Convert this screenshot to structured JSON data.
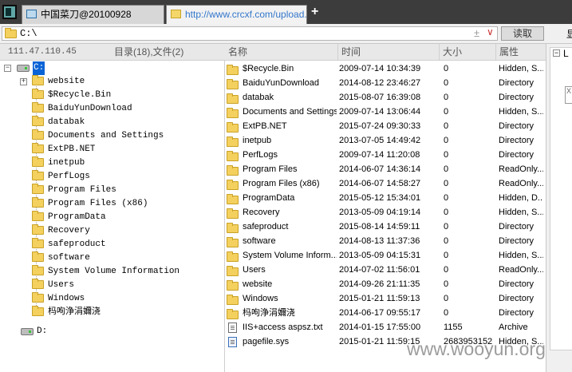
{
  "tabs": [
    {
      "label": "中国菜刀@20100928"
    },
    {
      "label": "http://www.crcxf.com/upload..."
    }
  ],
  "new_tab_label": "+",
  "toolbar": {
    "path": "C:\\",
    "read_label": "读取",
    "extra_label": "显"
  },
  "info": {
    "ip": "111.47.110.45",
    "counts": "目录(18),文件(2)"
  },
  "tree": {
    "root": "C:",
    "folders": [
      "website",
      "$Recycle.Bin",
      "BaiduYunDownload",
      "databak",
      "Documents and Settings",
      "ExtPB.NET",
      "inetpub",
      "PerfLogs",
      "Program Files",
      "Program Files (x86)",
      "ProgramData",
      "Recovery",
      "safeproduct",
      "software",
      "System Volume Information",
      "Users",
      "Windows",
      "杩呴浄涓嬭浇"
    ],
    "drive2": "D:"
  },
  "columns": {
    "name": "名称",
    "time": "时间",
    "size": "大小",
    "attr": "属性"
  },
  "files": [
    {
      "name": "$Recycle.Bin",
      "time": "2009-07-14 10:34:39",
      "size": "0",
      "attr": "Hidden, S...",
      "type": "folder"
    },
    {
      "name": "BaiduYunDownload",
      "time": "2014-08-12 23:46:27",
      "size": "0",
      "attr": "Directory",
      "type": "folder"
    },
    {
      "name": "databak",
      "time": "2015-08-07 16:39:08",
      "size": "0",
      "attr": "Directory",
      "type": "folder"
    },
    {
      "name": "Documents and Settings",
      "time": "2009-07-14 13:06:44",
      "size": "0",
      "attr": "Hidden, S...",
      "type": "folder"
    },
    {
      "name": "ExtPB.NET",
      "time": "2015-07-24 09:30:33",
      "size": "0",
      "attr": "Directory",
      "type": "folder"
    },
    {
      "name": "inetpub",
      "time": "2013-07-05 14:49:42",
      "size": "0",
      "attr": "Directory",
      "type": "folder"
    },
    {
      "name": "PerfLogs",
      "time": "2009-07-14 11:20:08",
      "size": "0",
      "attr": "Directory",
      "type": "folder"
    },
    {
      "name": "Program Files",
      "time": "2014-06-07 14:36:14",
      "size": "0",
      "attr": "ReadOnly...",
      "type": "folder"
    },
    {
      "name": "Program Files (x86)",
      "time": "2014-06-07 14:58:27",
      "size": "0",
      "attr": "ReadOnly...",
      "type": "folder"
    },
    {
      "name": "ProgramData",
      "time": "2015-05-12 15:34:01",
      "size": "0",
      "attr": "Hidden, D...",
      "type": "folder"
    },
    {
      "name": "Recovery",
      "time": "2013-05-09 04:19:14",
      "size": "0",
      "attr": "Hidden, S...",
      "type": "folder"
    },
    {
      "name": "safeproduct",
      "time": "2015-08-14 14:59:11",
      "size": "0",
      "attr": "Directory",
      "type": "folder"
    },
    {
      "name": "software",
      "time": "2014-08-13 11:37:36",
      "size": "0",
      "attr": "Directory",
      "type": "folder"
    },
    {
      "name": "System Volume Inform...",
      "time": "2013-05-09 04:15:31",
      "size": "0",
      "attr": "Hidden, S...",
      "type": "folder"
    },
    {
      "name": "Users",
      "time": "2014-07-02 11:56:01",
      "size": "0",
      "attr": "ReadOnly...",
      "type": "folder"
    },
    {
      "name": "website",
      "time": "2014-09-26 21:11:35",
      "size": "0",
      "attr": "Directory",
      "type": "folder"
    },
    {
      "name": "Windows",
      "time": "2015-01-21 11:59:13",
      "size": "0",
      "attr": "Directory",
      "type": "folder"
    },
    {
      "name": "杩呴浄涓嬭浇",
      "time": "2014-06-17 09:55:17",
      "size": "0",
      "attr": "Directory",
      "type": "folder"
    },
    {
      "name": "IIS+access aspsz.txt",
      "time": "2014-01-15 17:55:00",
      "size": "1155",
      "attr": "Archive",
      "type": "file"
    },
    {
      "name": "pagefile.sys",
      "time": "2015-01-21 11:59:15",
      "size": "2683953152",
      "attr": "Hidden, S...",
      "type": "sys"
    }
  ],
  "right_panel": {
    "label": "L",
    "icon": "X"
  },
  "watermark": "www.wooyun.org"
}
